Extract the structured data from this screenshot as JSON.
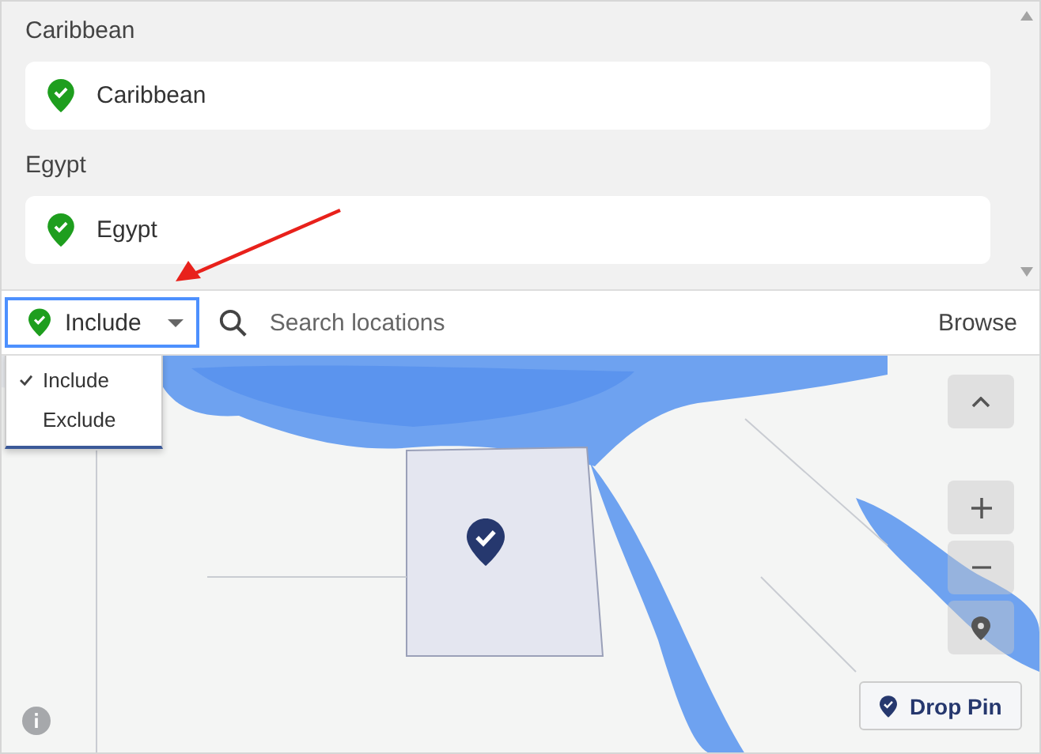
{
  "locations": [
    {
      "heading": "Caribbean",
      "name": "Caribbean"
    },
    {
      "heading": "Egypt",
      "name": "Egypt"
    }
  ],
  "mode_select": {
    "value": "Include",
    "open": true
  },
  "mode_menu": [
    {
      "label": "Include",
      "selected": true
    },
    {
      "label": "Exclude",
      "selected": false
    }
  ],
  "search": {
    "placeholder": "Search locations"
  },
  "browse": "Browse",
  "map": {
    "kind": "picture",
    "drop_pin": "Drop Pin"
  }
}
